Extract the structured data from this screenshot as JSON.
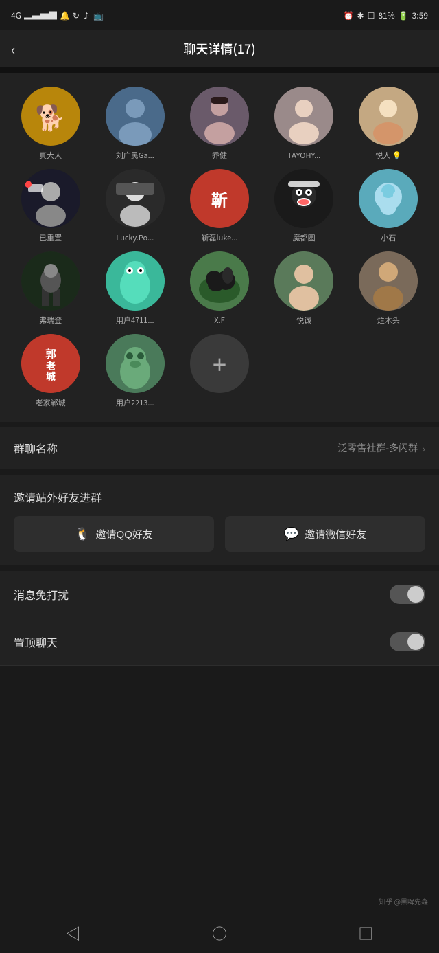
{
  "statusBar": {
    "signal": "4G",
    "wifi": "WiFi",
    "time": "3:59",
    "battery": "81%"
  },
  "header": {
    "title": "聊天详情(17)",
    "backLabel": "‹"
  },
  "members": [
    {
      "name": "真大人",
      "color": "#c8a86b",
      "emoji": "🐕",
      "id": "m1"
    },
    {
      "name": "刘广民Ga...",
      "color": "#4a6a8a",
      "emoji": "👤",
      "id": "m2"
    },
    {
      "name": "乔健",
      "color": "#7a4a4a",
      "emoji": "👩",
      "id": "m3"
    },
    {
      "name": "TAYOHY...",
      "color": "#9a8a7a",
      "emoji": "👸",
      "id": "m4"
    },
    {
      "name": "悦人 💡",
      "color": "#c4a882",
      "emoji": "👗",
      "id": "m5"
    },
    {
      "name": "已重置",
      "color": "#2a2a2a",
      "emoji": "😎",
      "id": "m6"
    },
    {
      "name": "Lucky.Po...",
      "color": "#3a3a3a",
      "emoji": "🕴",
      "id": "m7"
    },
    {
      "name": "靳磊luke...",
      "color": "#c0392b",
      "emoji": "靳",
      "id": "m8"
    },
    {
      "name": "魔都圆",
      "color": "#1a1a1a",
      "emoji": "🐻",
      "id": "m9"
    },
    {
      "name": "小石",
      "color": "#4a9aaa",
      "emoji": "👾",
      "id": "m10"
    },
    {
      "name": "弗瑞登",
      "color": "#2a4a2a",
      "emoji": "🏃",
      "id": "m11"
    },
    {
      "name": "用户4711...",
      "color": "#4ab89a",
      "emoji": "👾",
      "id": "m12"
    },
    {
      "name": "X.F",
      "color": "#4a8a4a",
      "emoji": "🐴",
      "id": "m13"
    },
    {
      "name": "悦诚",
      "color": "#6a8a6a",
      "emoji": "🧑",
      "id": "m14"
    },
    {
      "name": "烂木头",
      "color": "#7a6a5a",
      "emoji": "🧔",
      "id": "m15"
    },
    {
      "name": "老家郸城",
      "color": "#c0392b",
      "emoji": "郭",
      "id": "m16"
    },
    {
      "name": "用户2213...",
      "color": "#5a8a6a",
      "emoji": "🐸",
      "id": "m17"
    }
  ],
  "addButton": {
    "symbol": "+"
  },
  "groupName": {
    "label": "群聊名称",
    "value": "泛零售社群-多闪群"
  },
  "inviteSection": {
    "label": "邀请站外好友进群",
    "qqBtn": "邀请QQ好友",
    "wechatBtn": "邀请微信好友"
  },
  "toggleRows": [
    {
      "label": "消息免打扰",
      "on": false
    },
    {
      "label": "置顶聊天",
      "on": false
    }
  ],
  "bottomNav": {
    "back": "◁",
    "home": "○",
    "recent": "□",
    "watermark": "知乎 @黑啤先森"
  }
}
